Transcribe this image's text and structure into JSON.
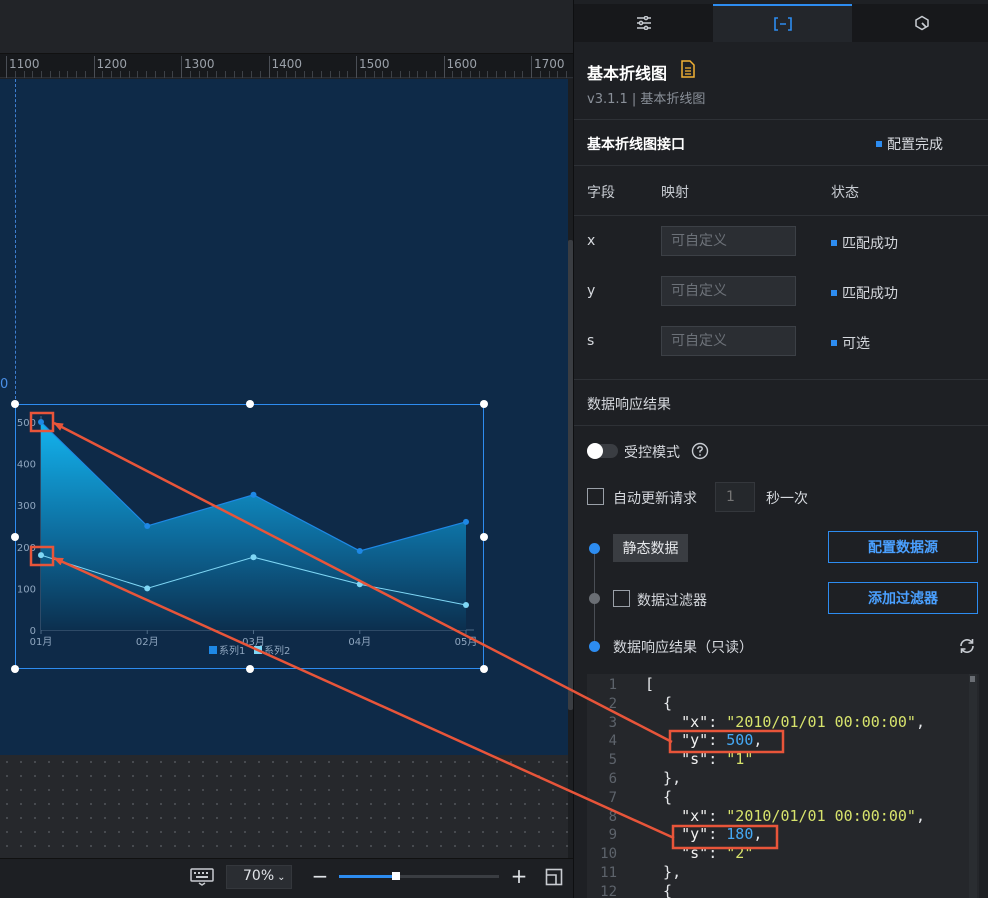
{
  "ruler": {
    "labels": [
      "1100",
      "1200",
      "1300",
      "1400",
      "1500",
      "1600",
      "1700"
    ]
  },
  "guide": {
    "label": "0"
  },
  "chart_data": {
    "type": "area",
    "categories": [
      "01月",
      "02月",
      "03月",
      "04月",
      "05月"
    ],
    "series": [
      {
        "name": "系列1",
        "values": [
          500,
          250,
          325,
          190,
          260
        ],
        "color": "#1e88e5"
      },
      {
        "name": "系列2",
        "values": [
          180,
          100,
          175,
          110,
          60
        ],
        "color": "#7fd7f5"
      }
    ],
    "y_ticks": [
      "0",
      "100",
      "200",
      "300",
      "400",
      "500"
    ],
    "ylim": [
      0,
      500
    ],
    "legend": "bottom-center",
    "grid": false
  },
  "bottom_bar": {
    "zoom_value": "70%",
    "zoom_fraction": 0.34,
    "minus_label": "−",
    "plus_label": "+"
  },
  "tabs": [
    {
      "name": "settings",
      "icon": "sliders-icon"
    },
    {
      "name": "data",
      "icon": "data-bracket-icon",
      "active": true
    },
    {
      "name": "interaction",
      "icon": "interaction-icon"
    }
  ],
  "component": {
    "title": "基本折线图",
    "version": "v3.1.1 | 基本折线图"
  },
  "api": {
    "title": "基本折线图接口",
    "status": "配置完成"
  },
  "mapping": {
    "headers": {
      "field": "字段",
      "map": "映射",
      "status": "状态"
    },
    "rows": [
      {
        "field": "x",
        "placeholder": "可自定义",
        "status": "匹配成功"
      },
      {
        "field": "y",
        "placeholder": "可自定义",
        "status": "匹配成功"
      },
      {
        "field": "s",
        "placeholder": "可自定义",
        "status": "可选"
      }
    ]
  },
  "response": {
    "title": "数据响应结果",
    "controlled_mode": "受控模式",
    "auto_update": "自动更新请求",
    "interval_placeholder": "1",
    "interval_unit": "秒一次",
    "static_data": "静态数据",
    "config_source": "配置数据源",
    "data_filter": "数据过滤器",
    "add_filter": "添加过滤器",
    "result_readonly": "数据响应结果（只读）"
  },
  "editor": {
    "line_numbers": [
      "1",
      "2",
      "3",
      "4",
      "5",
      "6",
      "7",
      "8",
      "9",
      "10",
      "11",
      "12"
    ],
    "lines": [
      [
        {
          "t": "[",
          "c": "p"
        }
      ],
      [
        {
          "t": "  {",
          "c": "p"
        }
      ],
      [
        {
          "t": "    \"x\"",
          "c": "k"
        },
        {
          "t": ": ",
          "c": "p"
        },
        {
          "t": "\"2010/01/01 00:00:00\"",
          "c": "s"
        },
        {
          "t": ",",
          "c": "p"
        }
      ],
      [
        {
          "t": "    \"y\"",
          "c": "k"
        },
        {
          "t": ": ",
          "c": "p"
        },
        {
          "t": "500",
          "c": "n"
        },
        {
          "t": ",",
          "c": "p"
        }
      ],
      [
        {
          "t": "    \"s\"",
          "c": "k"
        },
        {
          "t": ": ",
          "c": "p"
        },
        {
          "t": "\"1\"",
          "c": "s"
        }
      ],
      [
        {
          "t": "  },",
          "c": "p"
        }
      ],
      [
        {
          "t": "  {",
          "c": "p"
        }
      ],
      [
        {
          "t": "    \"x\"",
          "c": "k"
        },
        {
          "t": ": ",
          "c": "p"
        },
        {
          "t": "\"2010/01/01 00:00:00\"",
          "c": "s"
        },
        {
          "t": ",",
          "c": "p"
        }
      ],
      [
        {
          "t": "    \"y\"",
          "c": "k"
        },
        {
          "t": ": ",
          "c": "p"
        },
        {
          "t": "180",
          "c": "n"
        },
        {
          "t": ",",
          "c": "p"
        }
      ],
      [
        {
          "t": "    \"s\"",
          "c": "k"
        },
        {
          "t": ": ",
          "c": "p"
        },
        {
          "t": "\"2\"",
          "c": "s"
        }
      ],
      [
        {
          "t": "  },",
          "c": "p"
        }
      ],
      [
        {
          "t": "  {",
          "c": "p"
        }
      ]
    ]
  },
  "colors": {
    "accent": "#2d8cf0",
    "annotation": "#e8553a"
  }
}
